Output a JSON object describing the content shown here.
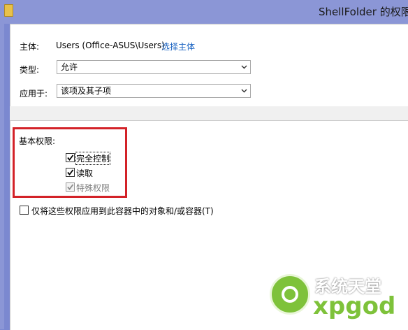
{
  "window": {
    "title": "ShellFolder 的权限"
  },
  "principal": {
    "label": "主体:",
    "value": "Users (Office-ASUS\\Users)",
    "select_link": "选择主体"
  },
  "type": {
    "label": "类型:",
    "value": "允许"
  },
  "applies_to": {
    "label": "应用于:",
    "value": "该项及其子项"
  },
  "basic_permissions": {
    "heading": "基本权限:",
    "items": [
      {
        "label": "完全控制",
        "checked": true,
        "enabled": true
      },
      {
        "label": "读取",
        "checked": true,
        "enabled": true
      },
      {
        "label": "特殊权限",
        "checked": true,
        "enabled": false
      }
    ]
  },
  "inherit_option": {
    "label": "仅将这些权限应用到此容器中的对象和/或容器(T)",
    "checked": false
  },
  "watermark": {
    "line1": "系统天堂",
    "line2": "xpgod"
  },
  "colors": {
    "window_bg": "#7b88d0",
    "link": "#1a63c2",
    "highlight_box": "#d32228",
    "watermark_green": "#7ec23a"
  }
}
